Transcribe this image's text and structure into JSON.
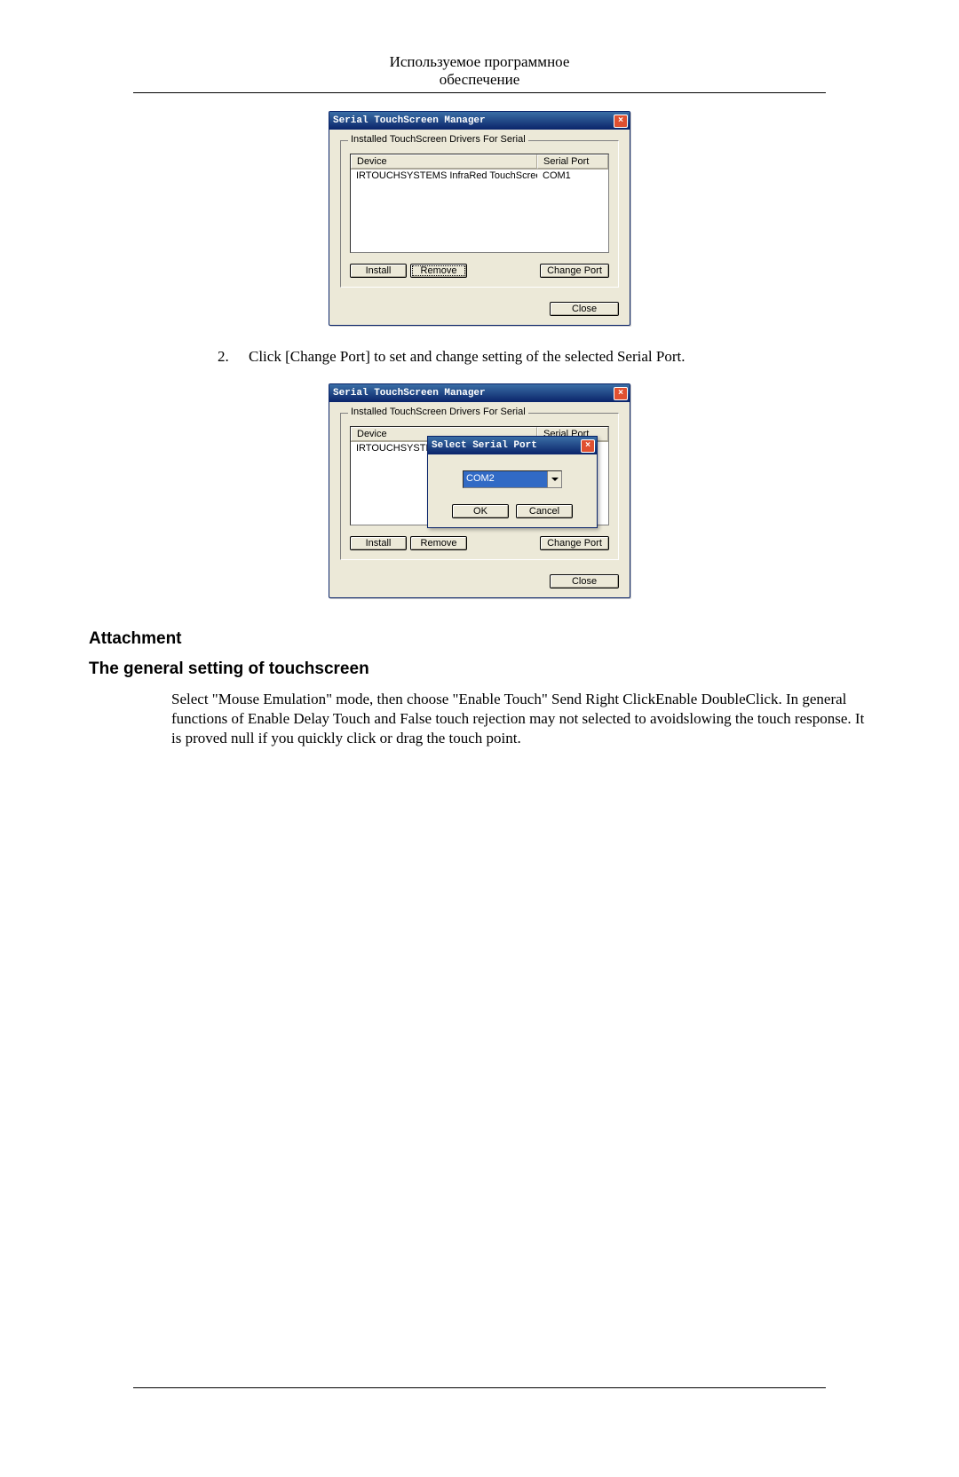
{
  "header": {
    "line1": "Используемое программное",
    "line2": "обеспечение"
  },
  "dialog": {
    "title": "Serial TouchScreen Manager",
    "group_legend": "Installed TouchScreen Drivers For Serial",
    "col_device": "Device",
    "col_port": "Serial Port",
    "row_device": "IRTOUCHSYSTEMS InfraRed TouchScreen",
    "row_device_trunc": "IRTOUCHSYSTE",
    "row_port": "COM1",
    "btn_install": "Install",
    "btn_remove": "Remove",
    "btn_change_port": "Change Port",
    "btn_close": "Close",
    "close_x": "×"
  },
  "inner_dialog": {
    "title": "Select Serial Port",
    "selected": "COM2",
    "btn_ok": "OK",
    "btn_cancel": "Cancel",
    "close_x": "×"
  },
  "step": {
    "num": "2.",
    "text": "Click [Change Port] to set and change setting of the selected Serial Port."
  },
  "section": {
    "attachment": "Attachment",
    "general": "The general setting of touchscreen",
    "body": "Select \"Mouse Emulation\" mode, then choose \"Enable Touch\" Send Right ClickEnable DoubleClick. In general functions of Enable Delay Touch and False touch rejection may not selected to avoidslowing the touch response. It is proved null if you quickly click or drag the touch point."
  }
}
